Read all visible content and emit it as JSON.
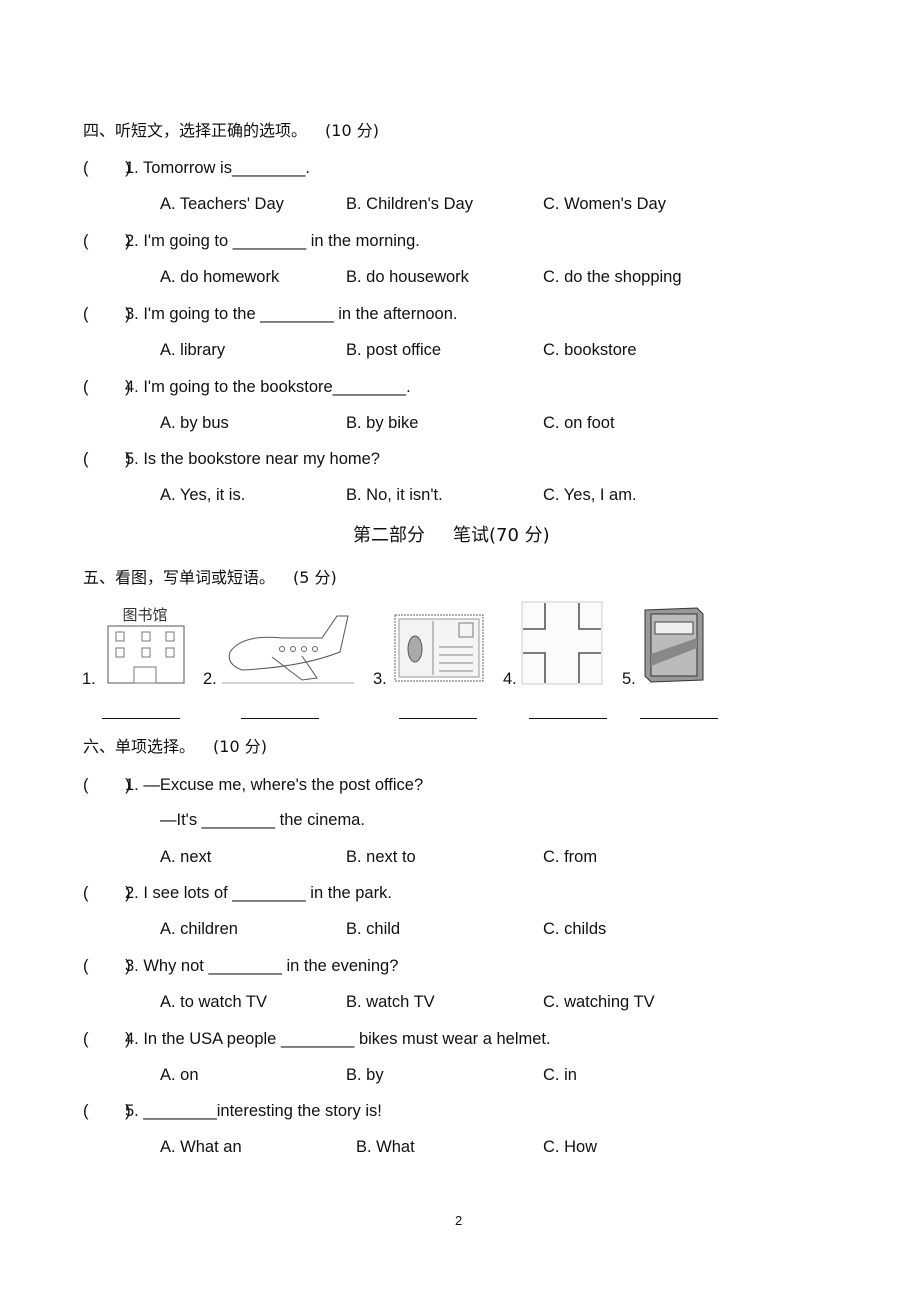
{
  "section4": {
    "heading": "四、听短文，选择正确的选项。",
    "score": "(10 分)",
    "questions": [
      {
        "paren": "(        )",
        "q": "1. Tomorrow is________.",
        "opts": [
          "A. Teachers' Day",
          "B. Children's Day",
          "C. Women's Day"
        ]
      },
      {
        "paren": "(        )",
        "q": "2. I'm going to ________ in the morning.",
        "opts": [
          "A. do homework",
          "B. do housework",
          "C. do the shopping"
        ]
      },
      {
        "paren": "(        )",
        "q": "3. I'm going to the ________ in the afternoon.",
        "opts": [
          "A. library",
          "B. post office",
          "C. bookstore"
        ]
      },
      {
        "paren": "(        )",
        "q": "4. I'm going to the bookstore________.",
        "opts": [
          "A. by bus",
          "B. by bike",
          "C. on foot"
        ]
      },
      {
        "paren": "(        )",
        "q": "5. Is the bookstore near my home?",
        "opts": [
          "A. Yes, it is.",
          "B. No, it isn't.",
          "C. Yes, I am."
        ]
      }
    ]
  },
  "part2": {
    "title": "第二部分",
    "subtitle": "笔试(70 分)"
  },
  "section5": {
    "heading": "五、看图，写单词或短语。",
    "score": "(5 分)",
    "items": [
      {
        "num": "1.",
        "picture": "library-building",
        "sign": "图书馆"
      },
      {
        "num": "2.",
        "picture": "airplane"
      },
      {
        "num": "3.",
        "picture": "postcard"
      },
      {
        "num": "4.",
        "picture": "crossroads"
      },
      {
        "num": "5.",
        "picture": "dictionary-book"
      }
    ]
  },
  "section6": {
    "heading": "六、单项选择。",
    "score": "(10 分)",
    "questions": [
      {
        "paren": "(        )",
        "q": "1. —Excuse me, where's the post office?",
        "q2": "—It's ________ the cinema.",
        "opts": [
          "A. next",
          "B. next to",
          "C. from"
        ]
      },
      {
        "paren": "(        )",
        "q": "2. I see lots of ________ in the park.",
        "opts": [
          "A. children",
          "B. child",
          "C. childs"
        ]
      },
      {
        "paren": "(        )",
        "q": "3. Why not ________ in the evening?",
        "opts": [
          "A. to watch TV",
          "B. watch TV",
          "C. watching TV"
        ]
      },
      {
        "paren": "(        )",
        "q": "4. In the USA people ________ bikes must wear a helmet.",
        "opts": [
          "A. on",
          "B. by",
          "C. in"
        ]
      },
      {
        "paren": "(        )",
        "q": "5. ________interesting the story is!",
        "opts": [
          "A. What an",
          "B. What",
          "C. How"
        ]
      }
    ]
  },
  "page_number": "2"
}
